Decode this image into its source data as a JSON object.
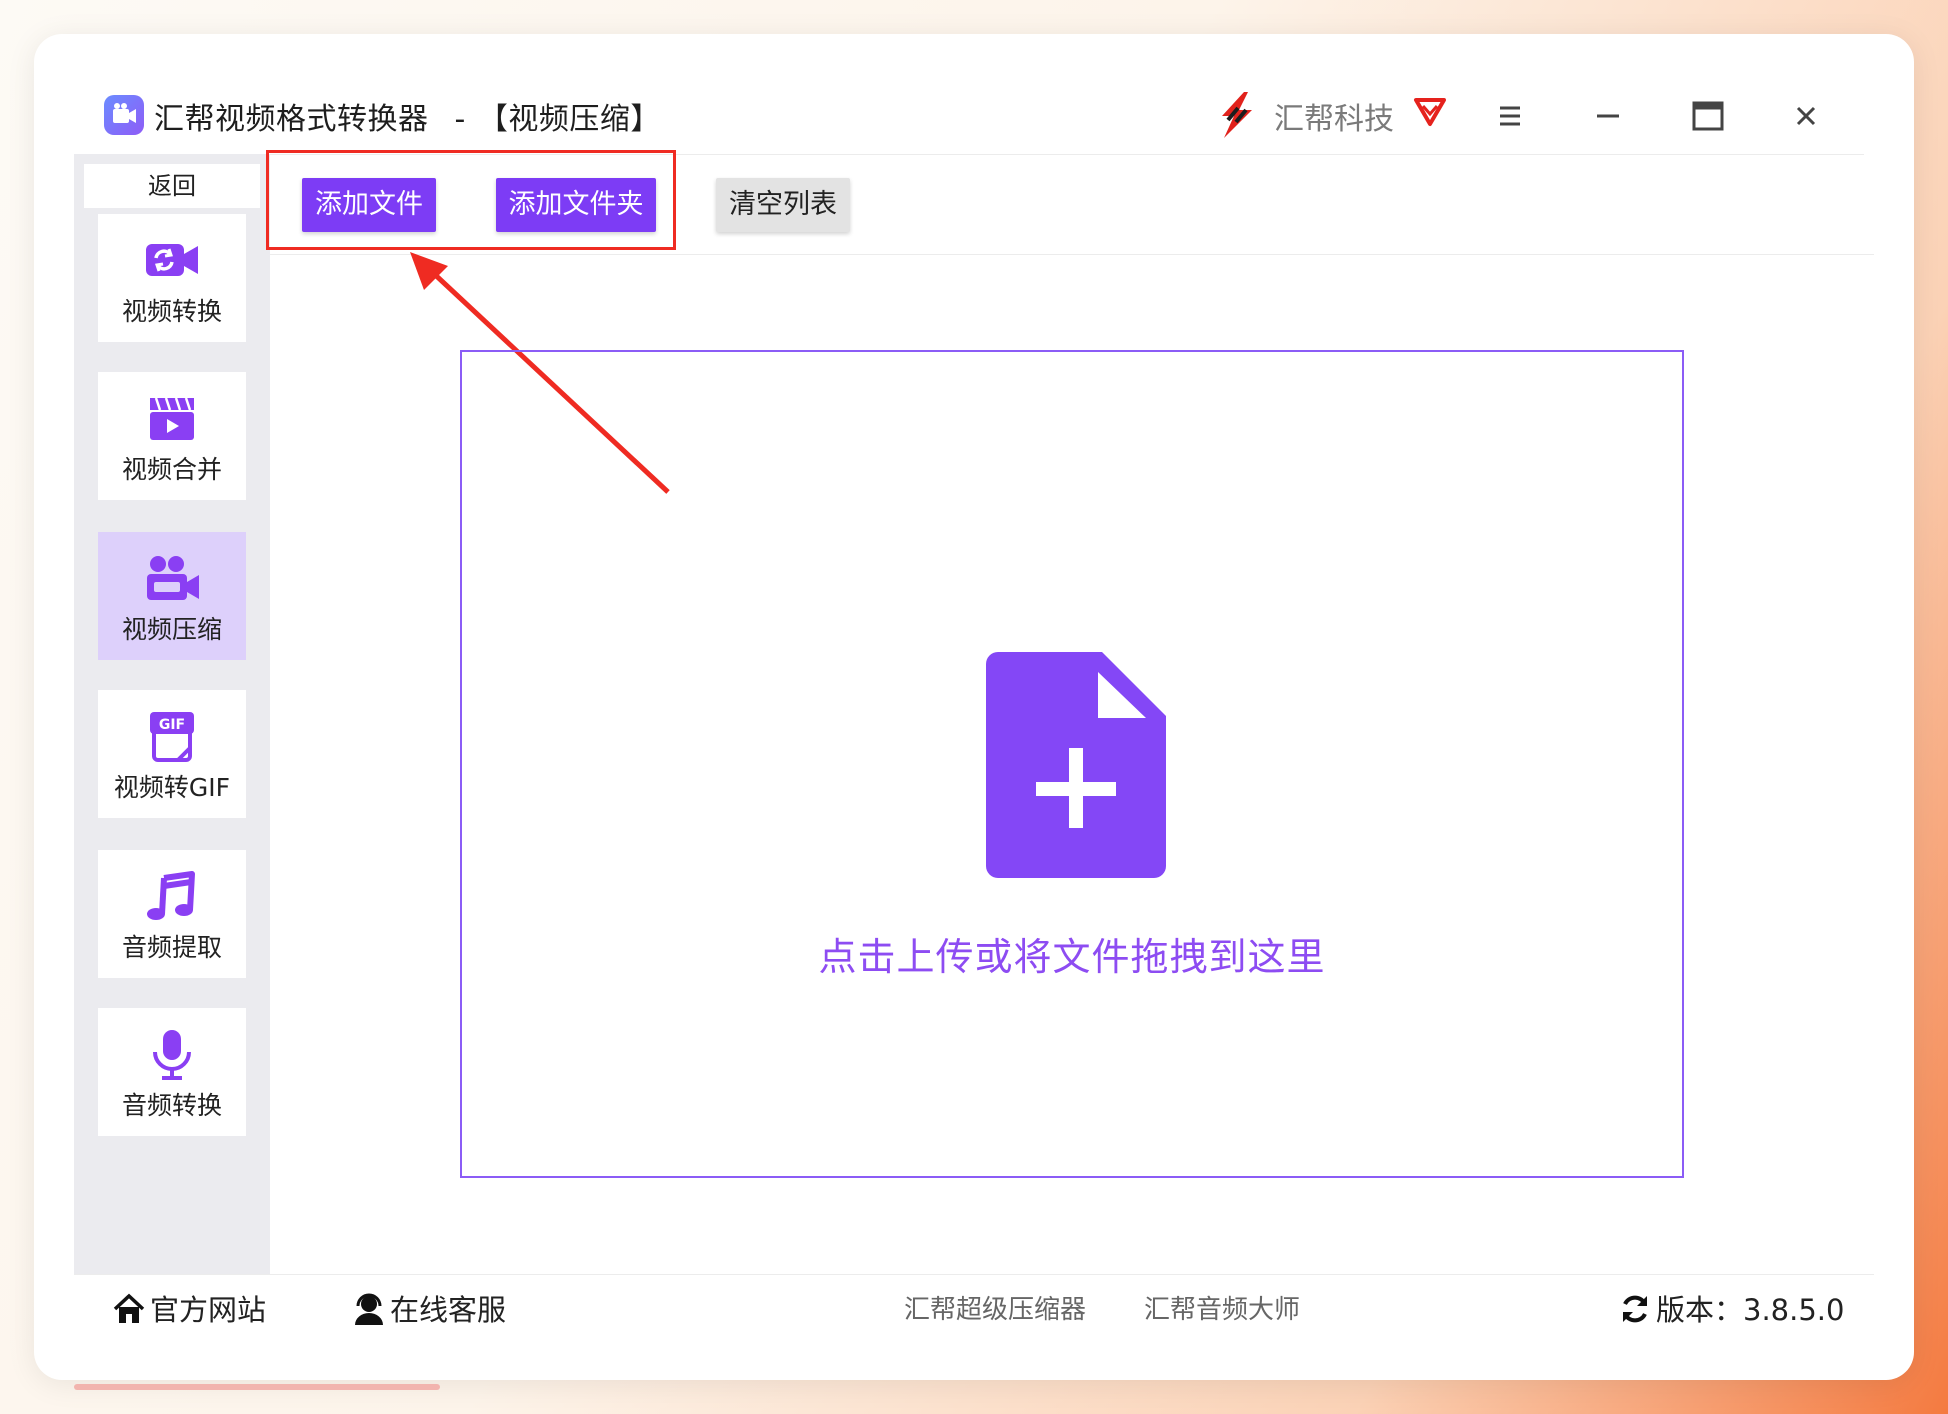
{
  "titlebar": {
    "app_name": "汇帮视频格式转换器",
    "separator": "-",
    "section": "【视频压缩】",
    "brand": "汇帮科技"
  },
  "sidebar": {
    "back": "返回",
    "items": [
      {
        "label": "视频转换",
        "icon": "video-convert-icon"
      },
      {
        "label": "视频合并",
        "icon": "video-merge-icon"
      },
      {
        "label": "视频压缩",
        "icon": "video-compress-icon",
        "active": true
      },
      {
        "label": "视频转GIF",
        "icon": "gif-icon"
      },
      {
        "label": "音频提取",
        "icon": "music-note-icon"
      },
      {
        "label": "音频转换",
        "icon": "microphone-icon"
      }
    ]
  },
  "toolbar": {
    "add_file": "添加文件",
    "add_folder": "添加文件夹",
    "clear_list": "清空列表"
  },
  "dropzone": {
    "text": "点击上传或将文件拖拽到这里"
  },
  "statusbar": {
    "website": "官方网站",
    "support": "在线客服",
    "link1": "汇帮超级压缩器",
    "link2": "汇帮音频大师",
    "version": "版本：3.8.5.0"
  },
  "colors": {
    "accent": "#7d3cf5",
    "highlight": "#ef2b22",
    "active_bg": "#ddd0fb"
  }
}
